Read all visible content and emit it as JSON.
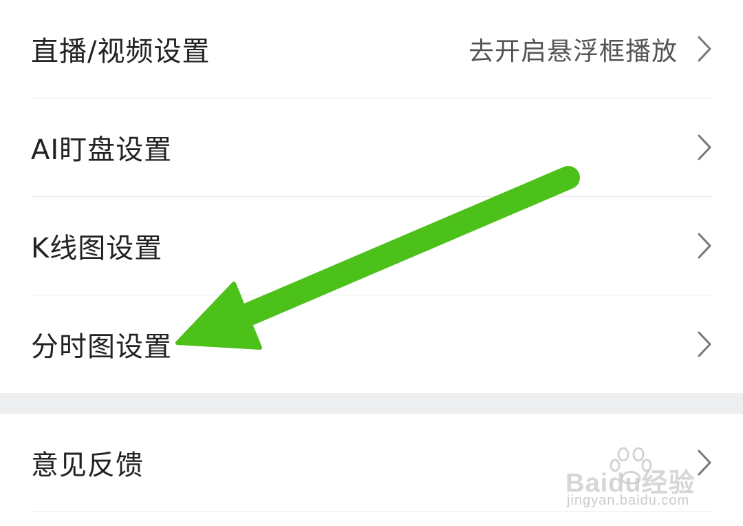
{
  "settings_group_1": {
    "items": [
      {
        "label": "直播/视频设置",
        "value": "去开启悬浮框播放"
      },
      {
        "label": "AI盯盘设置",
        "value": ""
      },
      {
        "label": "K线图设置",
        "value": ""
      },
      {
        "label": "分时图设置",
        "value": ""
      }
    ]
  },
  "settings_group_2": {
    "items": [
      {
        "label": "意见反馈",
        "value": ""
      }
    ]
  },
  "watermark": {
    "brand": "Baidu经验",
    "url": "jingyan.baidu.com"
  },
  "colors": {
    "annotation_arrow": "#4cc11a",
    "section_gap": "#eeeff0",
    "divider": "#e6e6e6",
    "chevron": "#777777"
  },
  "icons": {
    "chevron": "chevron-right-icon",
    "annotation": "arrow-annotation",
    "watermark_logo": "baidu-paw-icon"
  }
}
